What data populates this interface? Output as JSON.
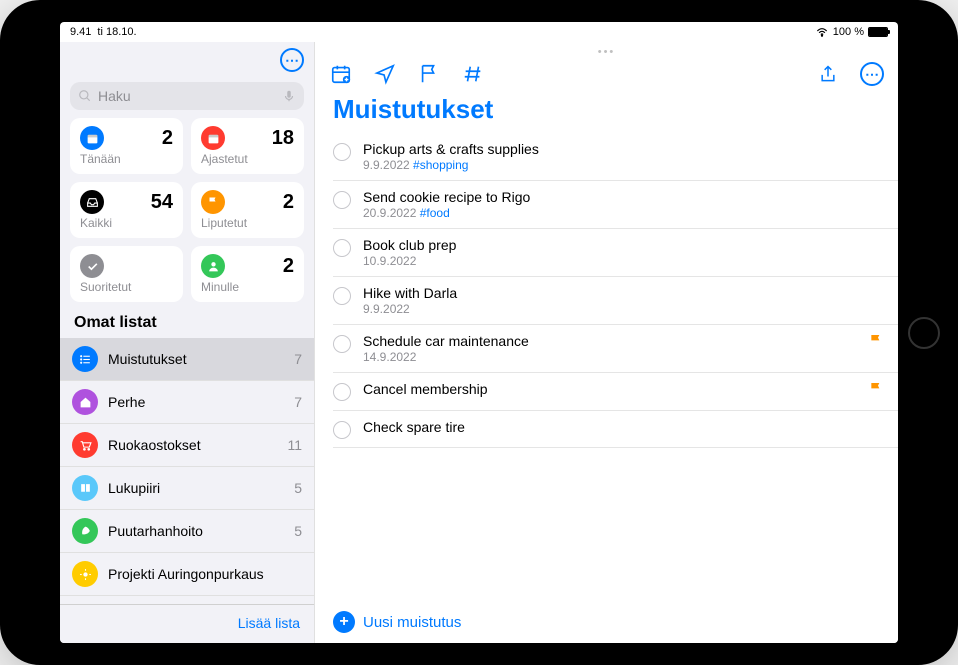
{
  "status": {
    "time": "9.41",
    "date": "ti 18.10.",
    "battery": "100 %"
  },
  "sidebar": {
    "search_placeholder": "Haku",
    "cards": [
      {
        "label": "Tänään",
        "count": "2",
        "color": "#007aff",
        "icon": "calendar"
      },
      {
        "label": "Ajastetut",
        "count": "18",
        "color": "#ff3b30",
        "icon": "calendar"
      },
      {
        "label": "Kaikki",
        "count": "54",
        "color": "#000000",
        "icon": "tray"
      },
      {
        "label": "Liputetut",
        "count": "2",
        "color": "#ff9500",
        "icon": "flag"
      },
      {
        "label": "Suoritetut",
        "count": "",
        "color": "#8e8e93",
        "icon": "check"
      },
      {
        "label": "Minulle",
        "count": "2",
        "color": "#34c759",
        "icon": "person"
      }
    ],
    "section_title": "Omat listat",
    "lists": [
      {
        "name": "Muistutukset",
        "count": "7",
        "color": "#007aff",
        "icon": "list",
        "selected": true
      },
      {
        "name": "Perhe",
        "count": "7",
        "color": "#af52de",
        "icon": "home",
        "selected": false
      },
      {
        "name": "Ruokaostokset",
        "count": "11",
        "color": "#ff3b30",
        "icon": "cart",
        "selected": false
      },
      {
        "name": "Lukupiiri",
        "count": "5",
        "color": "#5ac8fa",
        "icon": "book",
        "selected": false
      },
      {
        "name": "Puutarhanhoito",
        "count": "5",
        "color": "#34c759",
        "icon": "leaf",
        "selected": false
      },
      {
        "name": "Projekti Auringonpurkaus",
        "count": "",
        "color": "#ffcc00",
        "icon": "sun",
        "selected": false
      }
    ],
    "add_list": "Lisää lista"
  },
  "main": {
    "title": "Muistutukset",
    "reminders": [
      {
        "title": "Pickup arts & crafts supplies",
        "date": "9.9.2022",
        "tag": "#shopping",
        "flagged": false
      },
      {
        "title": "Send cookie recipe to Rigo",
        "date": "20.9.2022",
        "tag": "#food",
        "flagged": false
      },
      {
        "title": "Book club prep",
        "date": "10.9.2022",
        "tag": "",
        "flagged": false
      },
      {
        "title": "Hike with Darla",
        "date": "9.9.2022",
        "tag": "",
        "flagged": false
      },
      {
        "title": "Schedule car maintenance",
        "date": "14.9.2022",
        "tag": "",
        "flagged": true
      },
      {
        "title": "Cancel membership",
        "date": "",
        "tag": "",
        "flagged": true
      },
      {
        "title": "Check spare tire",
        "date": "",
        "tag": "",
        "flagged": false
      }
    ],
    "new_reminder": "Uusi muistutus"
  }
}
